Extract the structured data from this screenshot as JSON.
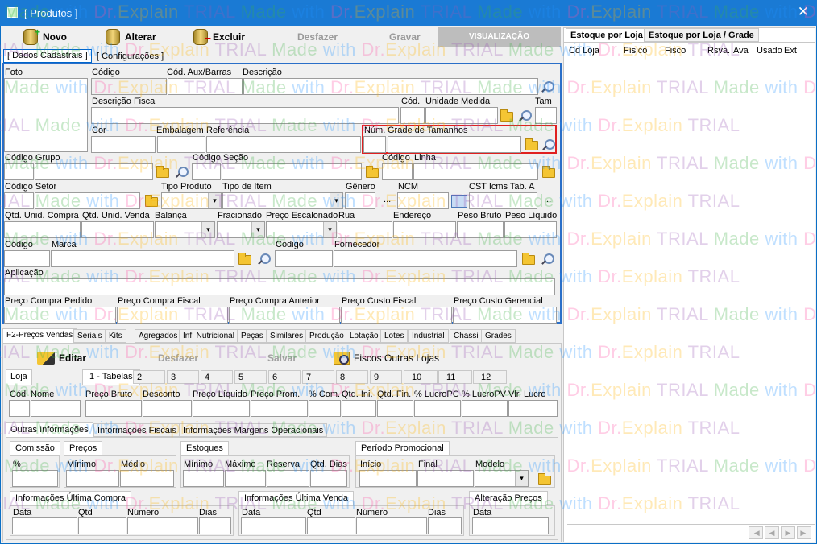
{
  "window": {
    "title": "[ Produtos ]",
    "close": "✕"
  },
  "toolbar": {
    "novo": "Novo",
    "novo_u": "N",
    "alterar": "Alterar",
    "alterar_u": "A",
    "excluir": "Excluir",
    "excluir_u": "E",
    "desfazer": "Desfazer",
    "gravar": "Gravar",
    "visualizacao": "VISUALIZAÇÃO"
  },
  "page_tabs": [
    "[ Dados Cadastrais ]",
    "[ Configurações ]"
  ],
  "labels": {
    "foto": "Foto",
    "codigo": "Código",
    "cod_aux": "Cód. Aux/Barras",
    "descricao": "Descrição",
    "descricao_fiscal": "Descrição Fiscal",
    "cod": "Cód.",
    "unidade_medida": "Unidade Medida",
    "tam": "Tam",
    "cor": "Cor",
    "embalagem": "Embalagem",
    "referencia": "Referência",
    "num": "Núm.",
    "grade_tamanhos": "Grade de Tamanhos",
    "codigo_grupo": "Código Grupo",
    "codigo_secao": "Código Seção",
    "codigo2": "Código",
    "linha": "Linha",
    "codigo_setor": "Código Setor",
    "tipo_produto": "Tipo Produto",
    "tipo_item": "Tipo de Item",
    "genero": "Gênero",
    "ncm": "NCM",
    "cst": "CST Icms Tab. A",
    "qtd_unid_compra": "Qtd. Unid. Compra",
    "qtd_unid_venda": "Qtd. Unid. Venda",
    "balanca": "Balança",
    "fracionado": "Fracionado",
    "preco_escalonado": "Preço Escalonado",
    "rua": "Rua",
    "endereco": "Endereço",
    "peso_bruto": "Peso Bruto",
    "peso_liquido": "Peso Líquido",
    "codigo3": "Código",
    "marca": "Marca",
    "codigo4": "Código",
    "fornecedor": "Fornecedor",
    "aplicacao": "Aplicação",
    "preco_compra_pedido": "Preço Compra Pedido",
    "preco_compra_fiscal": "Preço Compra Fiscal",
    "preco_compra_anterior": "Preço Compra Anterior",
    "preco_custo_fiscal": "Preço Custo Fiscal",
    "preco_custo_gerencial": "Preço Custo Gerencial",
    "dots": "..."
  },
  "bottom_tabs": [
    "F2-Preços Vendas",
    "Seriais",
    "Kits",
    "Agregados",
    "Inf. Nutricional",
    "Peças",
    "Similares",
    "Produção",
    "Lotação",
    "Lotes",
    "Industrial",
    "Chassi",
    "Grades"
  ],
  "actions": {
    "editar": "Editar",
    "desfazer": "Desfazer",
    "salvar": "Salvar",
    "fiscos": "Fiscos Outras Lojas"
  },
  "loja_tab": "Loja",
  "tabela_tabs": [
    "1 - Tabelas",
    "2",
    "3",
    "4",
    "5",
    "6",
    "7",
    "8",
    "9",
    "10",
    "11",
    "12"
  ],
  "price_cols": {
    "cod": "Cód",
    "nome": "Nome",
    "preco_bruto": "Preço Bruto",
    "desconto": "Desconto",
    "preco_liquido": "Preço Líquido",
    "preco_prom": "Preço Prom.",
    "pct_com": "% Com.",
    "qtd_ini": "Qtd. Ini.",
    "qtd_fin": "Qtd. Fin.",
    "pct_lucro_pc": "% LucroPC",
    "pct_lucro_pv": "% LucroPV",
    "vlr_lucro": "Vlr. Lucro"
  },
  "info_tabs": [
    "Outras Informações",
    "Informações Fiscais",
    "Informações Margens Operacionais"
  ],
  "groups": {
    "comissao": "Comissão",
    "pct": "%",
    "precos": "Preços",
    "minimo": "Mínimo",
    "medio": "Médio",
    "estoques": "Estoques",
    "minimo2": "Mínimo",
    "maximo": "Máximo",
    "reserva": "Reserva",
    "qtd_dias": "Qtd. Dias",
    "periodo": "Período Promocional",
    "inicio": "Início",
    "final": "Final",
    "modelo": "Modelo",
    "ult_compra": "Informações Última Compra",
    "ult_venda": "Informações Última Venda",
    "alteracao": "Alteração Preços",
    "data": "Data",
    "qtd": "Qtd",
    "numero": "Número",
    "dias": "Dias"
  },
  "right": {
    "tabs": [
      "Estoque por Loja",
      "Estoque por Loja / Grade"
    ],
    "cols": [
      "Cd Loja",
      "Físico",
      "Fisco",
      "Rsva.",
      "Ava",
      "Usado",
      "Ext"
    ],
    "nav": [
      "|◀",
      "◀",
      "▶",
      "▶|"
    ]
  },
  "watermark": {
    "made": "Made",
    "with": " with ",
    "dr": "Dr.",
    "explain": "Explain",
    "trial": " TRIAL"
  }
}
